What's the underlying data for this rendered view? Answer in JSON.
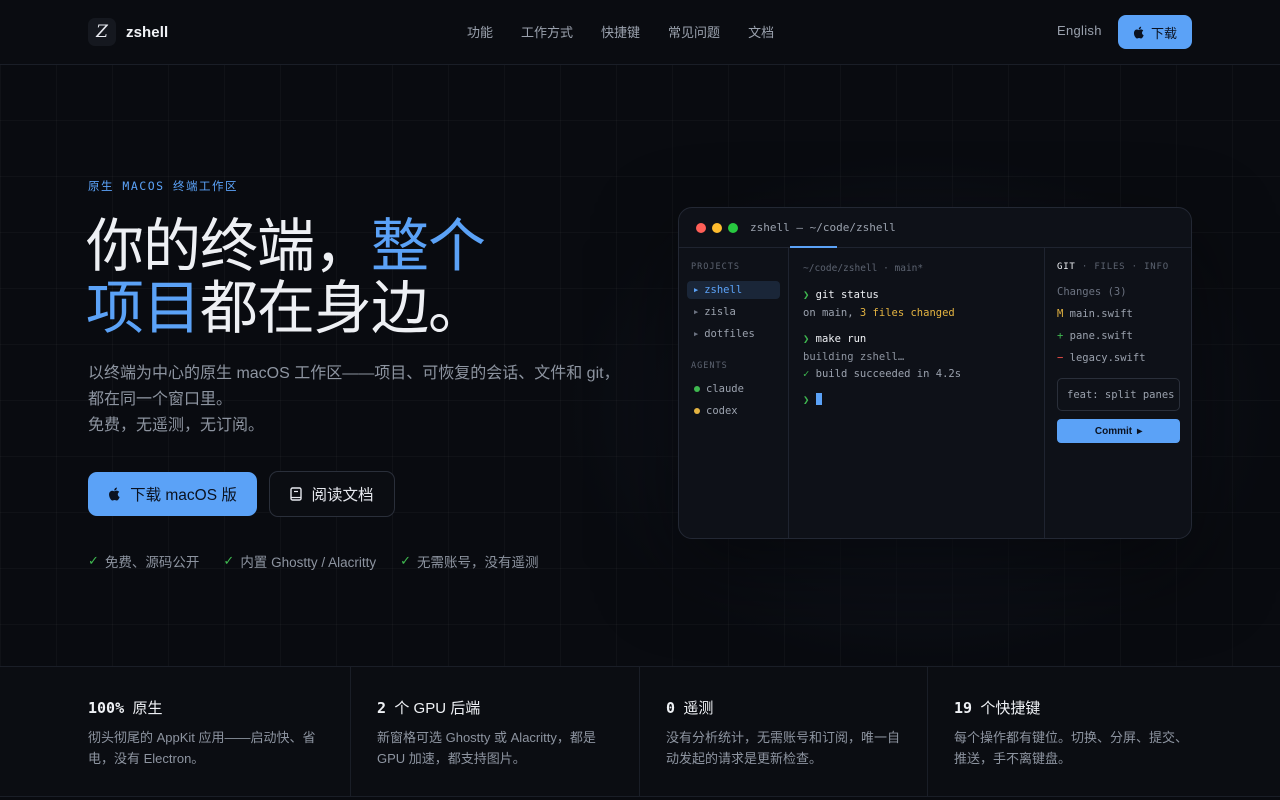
{
  "colors": {
    "accent": "#5ba2f7",
    "background": "#090b10",
    "success": "#3fb950",
    "warning": "#e3b341",
    "danger": "#f85149"
  },
  "header": {
    "brand_mark": "Z",
    "brand_name": "zshell",
    "nav": [
      "功能",
      "工作方式",
      "快捷键",
      "常见问题",
      "文档"
    ],
    "language": "English",
    "download_label": "下载"
  },
  "hero": {
    "eyebrow": "原生 MACOS 终端工作区",
    "title_part1": "你的终端，",
    "title_accent1": "整个",
    "title_accent2": "项目",
    "title_part2": "都在身边。",
    "subtitle_line1": "以终端为中心的原生 macOS 工作区——项目、可恢复的会话、文件和 git，",
    "subtitle_line2": "都在同一个窗口里。",
    "subtitle_line3": "免费，无遥测，无订阅。",
    "primary_button": "下载 macOS 版",
    "secondary_button": "阅读文档",
    "checks": [
      "免费、源码公开",
      "内置 Ghostty / Alacritty",
      "无需账号，没有遥测"
    ]
  },
  "terminal": {
    "title": "zshell — ~/code/zshell",
    "sidebar": {
      "projects_heading": "PROJECTS",
      "projects": [
        "zshell",
        "zisla",
        "dotfiles"
      ],
      "agents_heading": "AGENTS",
      "agents": [
        {
          "name": "claude",
          "color": "#3fb950"
        },
        {
          "name": "codex",
          "color": "#e3b341"
        }
      ]
    },
    "main": {
      "path": "~/code/zshell · main*",
      "prompt": "❯",
      "cmd1": "git status",
      "out1_prefix": "on main, ",
      "out1_highlight": "3 files changed",
      "cmd2": "make run",
      "out2": "building zshell…",
      "out3_check": "✓",
      "out3": "build succeeded in 4.2s"
    },
    "right": {
      "tabs": {
        "git": "GIT",
        "sep": "·",
        "files": "FILES",
        "info": "INFO"
      },
      "changes_label": "Changes (3)",
      "changes": [
        {
          "status": "M",
          "file": "main.swift",
          "color": "#e3b341"
        },
        {
          "status": "+",
          "file": "pane.swift",
          "color": "#3fb950"
        },
        {
          "status": "−",
          "file": "legacy.swift",
          "color": "#f85149"
        }
      ],
      "commit_message": "feat: split panes",
      "commit_button": "Commit",
      "commit_arrow": "▸"
    }
  },
  "stats": [
    {
      "num": "100%",
      "label": "原生",
      "desc1": "彻头彻尾的 AppKit 应用——启动快、省",
      "desc2": "电，没有 Electron。"
    },
    {
      "num": "2",
      "label": "个 GPU 后端",
      "desc1": "新窗格可选 Ghostty 或 Alacritty，都是",
      "desc2": "GPU 加速，都支持图片。"
    },
    {
      "num": "0",
      "label": "遥测",
      "desc1": "没有分析统计，无需账号和订阅，唯一自",
      "desc2": "动发起的请求是更新检查。"
    },
    {
      "num": "19",
      "label": "个快捷键",
      "desc1": "每个操作都有键位。切换、分屏、提交、",
      "desc2": "推送，手不离键盘。"
    }
  ]
}
